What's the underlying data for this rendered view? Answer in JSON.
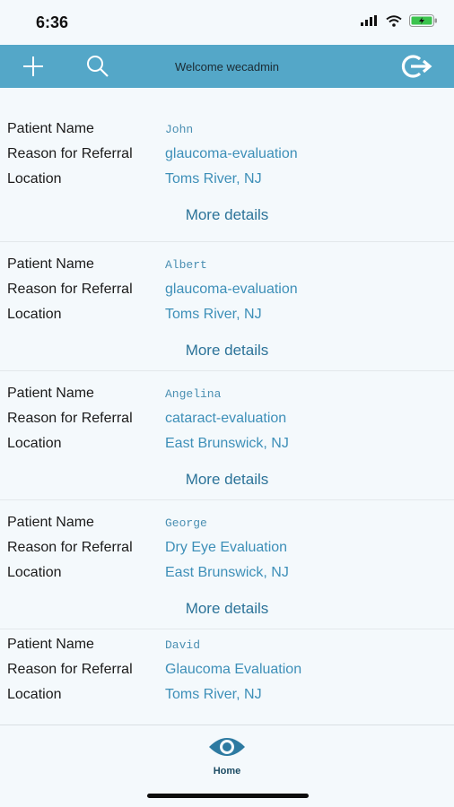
{
  "status_bar": {
    "time": "6:36"
  },
  "header": {
    "welcome": "Welcome wecadmin"
  },
  "labels": {
    "patient_name": "Patient Name",
    "reason": "Reason for Referral",
    "location": "Location",
    "more_details": "More details"
  },
  "referrals": [
    {
      "name": "John",
      "reason": "glaucoma-evaluation",
      "location": "Toms River, NJ"
    },
    {
      "name": "Albert",
      "reason": "glaucoma-evaluation",
      "location": "Toms River, NJ"
    },
    {
      "name": "Angelina",
      "reason": "cataract-evaluation",
      "location": "East Brunswick, NJ"
    },
    {
      "name": "George",
      "reason": "Dry Eye Evaluation",
      "location": "East Brunswick, NJ"
    },
    {
      "name": "David",
      "reason": "Glaucoma Evaluation",
      "location": "Toms River, NJ"
    }
  ],
  "tabbar": {
    "home_label": "Home"
  },
  "colors": {
    "header": "#54a7c8",
    "value": "#3d8fb8",
    "link": "#2c7399",
    "background": "#f4f9fc"
  },
  "icons": {
    "add": "plus-icon",
    "search": "search-icon",
    "logout": "logout-icon",
    "home": "eye-icon"
  }
}
